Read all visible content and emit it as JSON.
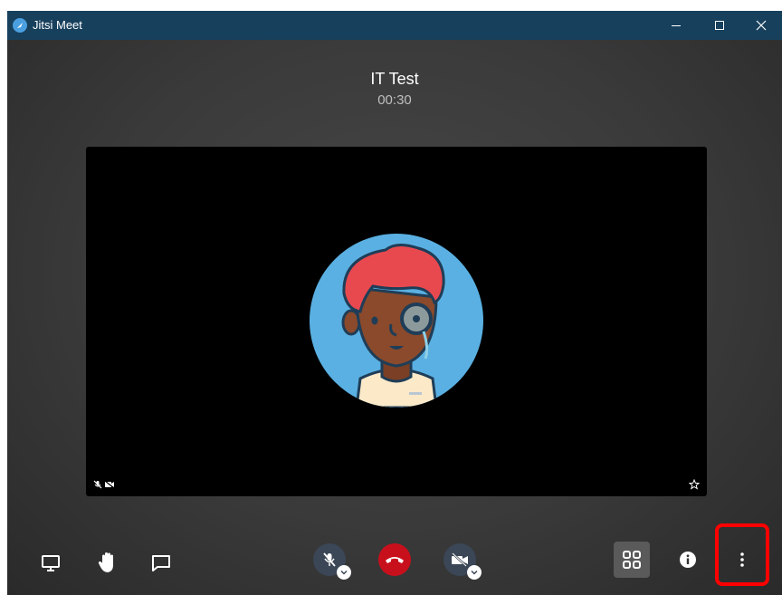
{
  "window": {
    "app_name": "Jitsi Meet",
    "title_bar_color": "#17405d",
    "controls": [
      "minimize-icon",
      "maximize-icon",
      "close-icon"
    ]
  },
  "meeting": {
    "title": "IT Test",
    "timer": "00:30"
  },
  "video_tile": {
    "avatar": "default-avatar-person-with-monocle",
    "status_icons": [
      "mic-muted-icon",
      "video-muted-icon"
    ],
    "corner_icon": "star-icon"
  },
  "toolbar": {
    "left": [
      "screen-share-icon",
      "raise-hand-icon",
      "chat-icon"
    ],
    "center": [
      "mic-muted-icon",
      "hangup-icon",
      "video-muted-icon"
    ],
    "right": [
      "tile-view-icon",
      "info-icon",
      "more-options-icon"
    ],
    "hangup_color": "#c8101c",
    "highlight_color": "#ff0000"
  }
}
